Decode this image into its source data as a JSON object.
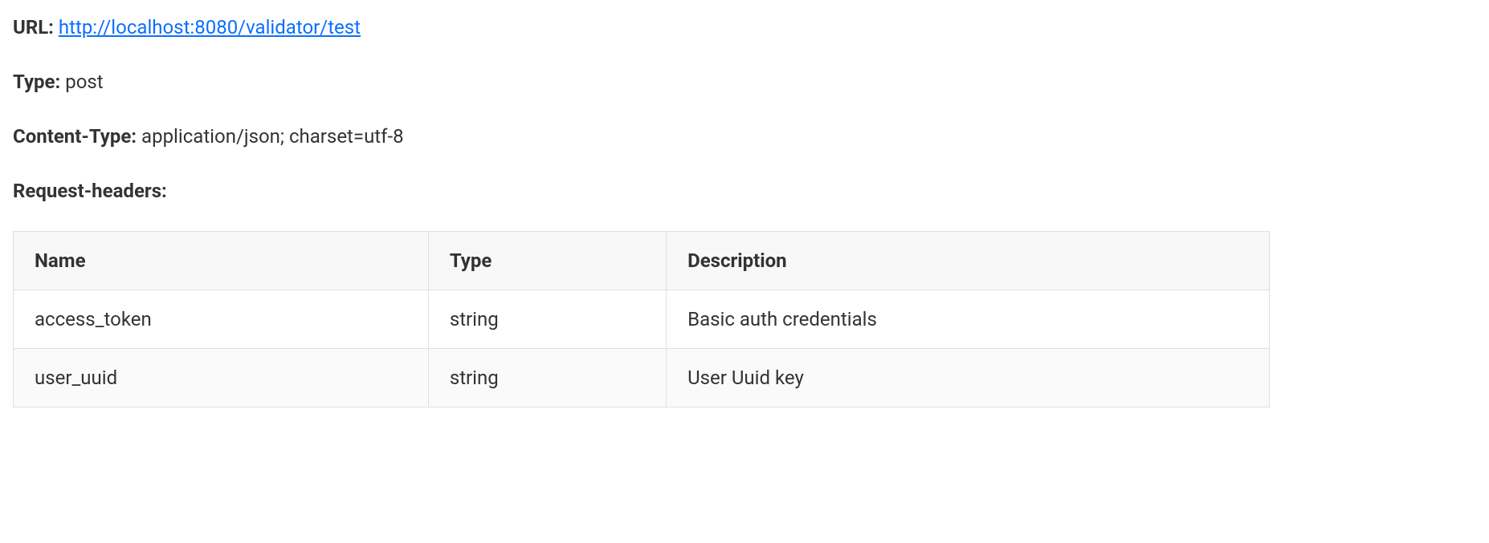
{
  "url": {
    "label": "URL:",
    "value": "http://localhost:8080/validator/test"
  },
  "type": {
    "label": "Type:",
    "value": "post"
  },
  "contentType": {
    "label": "Content-Type:",
    "value": "application/json; charset=utf-8"
  },
  "requestHeaders": {
    "label": "Request-headers:"
  },
  "table": {
    "headers": {
      "name": "Name",
      "type": "Type",
      "description": "Description"
    },
    "rows": [
      {
        "name": "access_token",
        "type": "string",
        "description": "Basic auth credentials"
      },
      {
        "name": "user_uuid",
        "type": "string",
        "description": "User Uuid key"
      }
    ]
  }
}
